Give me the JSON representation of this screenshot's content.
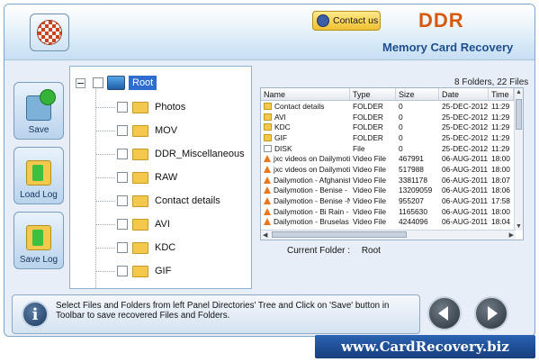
{
  "app": {
    "brand": "DDR",
    "subtitle": "Memory Card Recovery",
    "contact_label": "Contact us"
  },
  "toolbar": [
    {
      "label": "Save",
      "icon": "save-icon"
    },
    {
      "label": "Load Log",
      "icon": "load-log-icon"
    },
    {
      "label": "Save Log",
      "icon": "save-log-icon"
    }
  ],
  "tree": {
    "root": "Root",
    "items": [
      "Photos",
      "MOV",
      "DDR_Miscellaneous",
      "RAW",
      "Contact details",
      "AVI",
      "KDC",
      "GIF"
    ]
  },
  "files": {
    "count": "8 Folders, 22 Files",
    "columns": [
      "Name",
      "Type",
      "Size",
      "Date",
      "Time"
    ],
    "rows": [
      {
        "icon": "folder",
        "name": "Contact details",
        "type": "FOLDER",
        "size": "0",
        "date": "25-DEC-2012",
        "time": "11:29"
      },
      {
        "icon": "folder",
        "name": "AVI",
        "type": "FOLDER",
        "size": "0",
        "date": "25-DEC-2012",
        "time": "11:29"
      },
      {
        "icon": "folder",
        "name": "KDC",
        "type": "FOLDER",
        "size": "0",
        "date": "25-DEC-2012",
        "time": "11:29"
      },
      {
        "icon": "folder",
        "name": "GIF",
        "type": "FOLDER",
        "size": "0",
        "date": "25-DEC-2012",
        "time": "11:29"
      },
      {
        "icon": "file",
        "name": "DISK",
        "type": "File",
        "size": "0",
        "date": "25-DEC-2012",
        "time": "11:29"
      },
      {
        "icon": "video",
        "name": "jxc videos on Dailymoti...",
        "type": "Video File",
        "size": "467991",
        "date": "06-AUG-2011",
        "time": "18:00"
      },
      {
        "icon": "video",
        "name": "jxc videos on Dailymoti...",
        "type": "Video File",
        "size": "517988",
        "date": "06-AUG-2011",
        "time": "18:00"
      },
      {
        "icon": "video",
        "name": "Dailymotion - Afghanist...",
        "type": "Video File",
        "size": "3381178",
        "date": "06-AUG-2011",
        "time": "18:07"
      },
      {
        "icon": "video",
        "name": "Dailymotion - Benise - ...",
        "type": "Video File",
        "size": "13209059",
        "date": "06-AUG-2011",
        "time": "18:06"
      },
      {
        "icon": "video",
        "name": "Dailymotion - Benise -N...",
        "type": "Video File",
        "size": "955207",
        "date": "06-AUG-2011",
        "time": "17:58"
      },
      {
        "icon": "video",
        "name": "Dailymotion - Bi Rain - ...",
        "type": "Video File",
        "size": "1165630",
        "date": "06-AUG-2011",
        "time": "18:00"
      },
      {
        "icon": "video",
        "name": "Dailymotion - Bruselas ...",
        "type": "Video File",
        "size": "4244096",
        "date": "06-AUG-2011",
        "time": "18:04"
      }
    ],
    "current_folder_label": "Current Folder :",
    "current_folder_value": "Root"
  },
  "info": {
    "text": "Select Files and Folders from left Panel Directories' Tree and Click on 'Save' button in Toolbar to save recovered Files and Folders."
  },
  "footer": {
    "url": "www.CardRecovery.biz"
  }
}
